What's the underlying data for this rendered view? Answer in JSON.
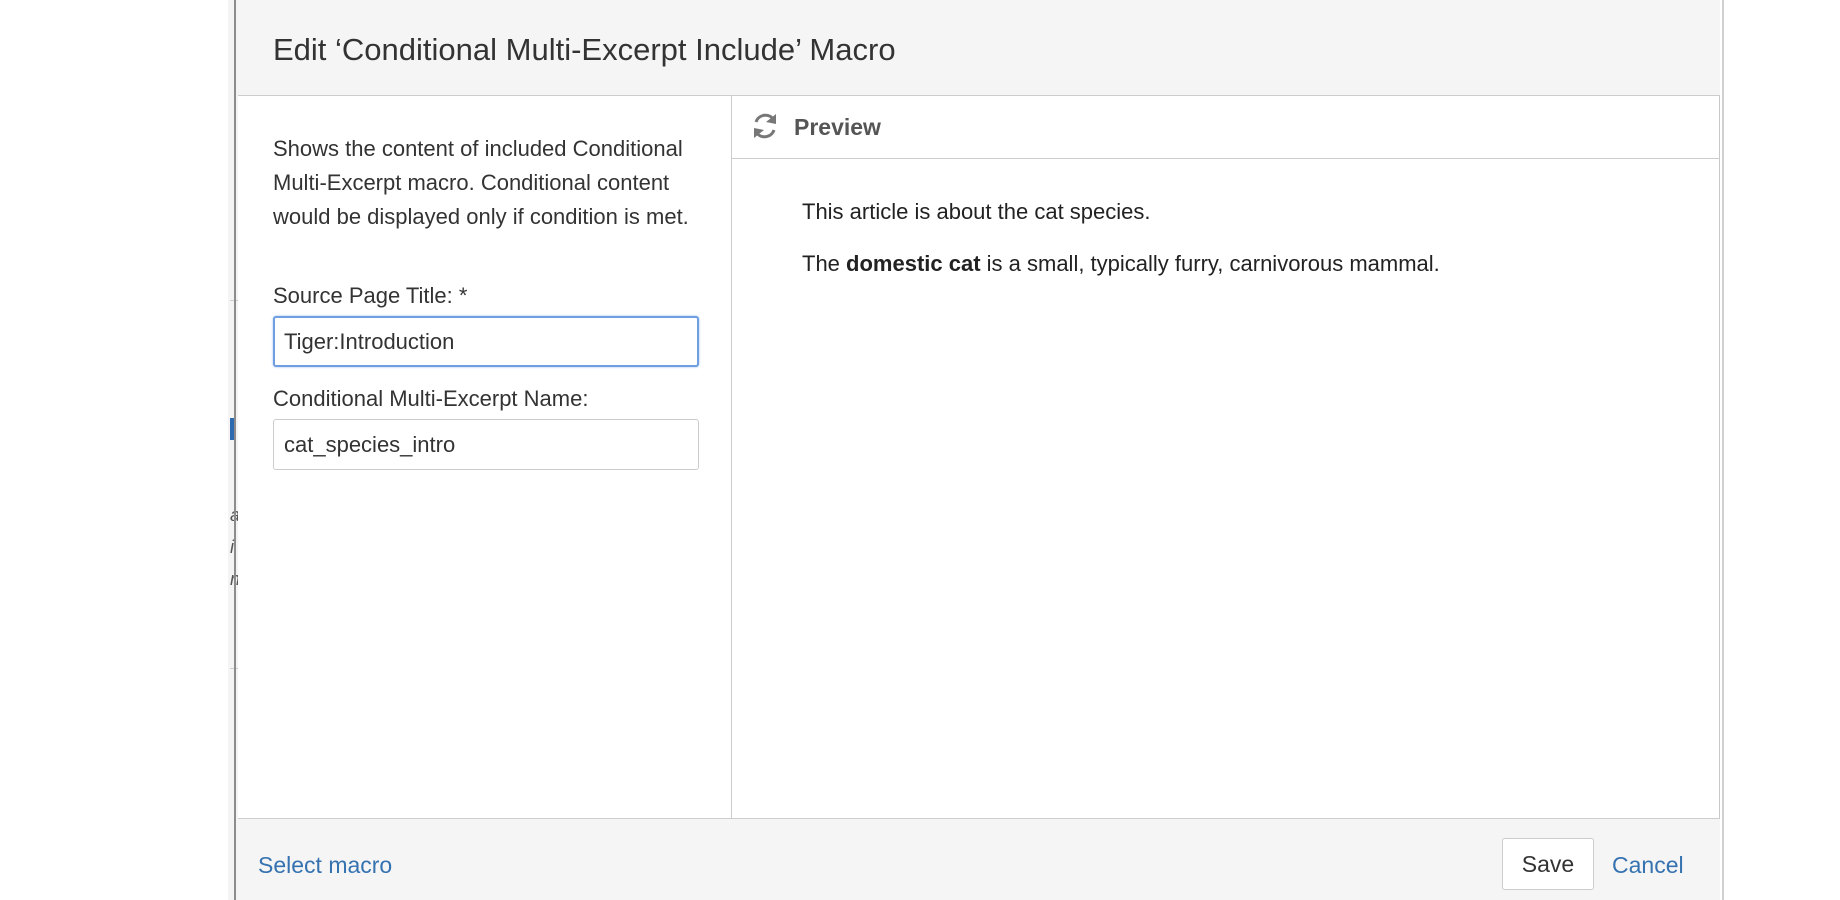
{
  "dialog": {
    "title": "Edit ‘Conditional Multi-Excerpt Include’ Macro"
  },
  "left_panel": {
    "description": "Shows the content of included Conditional Multi-Excerpt macro. Conditional content would be displayed only if condition is met.",
    "source_page": {
      "label": "Source Page Title: *",
      "value": "Tiger:Introduction"
    },
    "excerpt_name": {
      "label": "Conditional Multi-Excerpt Name:",
      "value": "cat_species_intro"
    }
  },
  "preview": {
    "title": "Preview",
    "refresh_icon": "refresh-icon",
    "paragraph1": "This article is about the cat species.",
    "paragraph2": {
      "prefix": "The ",
      "bold": "domestic cat",
      "suffix": " is a small, typically furry, carnivorous mammal."
    }
  },
  "footer": {
    "select_macro_label": "Select macro",
    "save_label": "Save",
    "cancel_label": "Cancel"
  },
  "background_fragments": [
    "a",
    "i",
    "n"
  ],
  "colors": {
    "link": "#3572b0",
    "focus_border": "#6f9fe0",
    "header_bg": "#f5f5f5"
  }
}
